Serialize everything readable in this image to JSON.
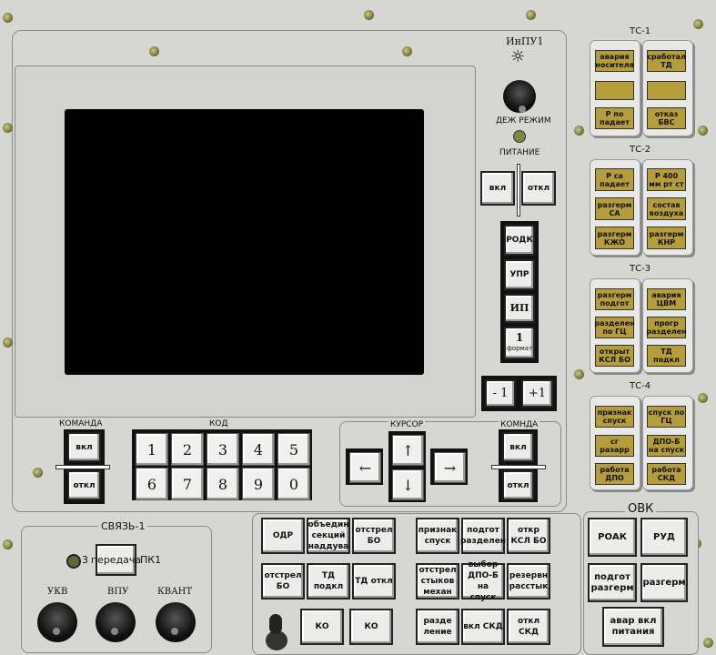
{
  "main": {
    "ikpu_label": "ИнПУ1",
    "dezh_label": "ДЕЖ РЕЖИМ",
    "pitanie_label": "ПИТАНИЕ",
    "pit_on": "вкл",
    "pit_off": "откл",
    "side_buttons": [
      "РОДК",
      "УПР",
      "ИП"
    ],
    "format_num": "1",
    "format_label": "формат",
    "minus": "- 1",
    "plus": "+1",
    "komanda_label": "КОМАНДА",
    "kom_on": "вкл",
    "kom_off": "откл",
    "kod_label": "КОД",
    "keys": [
      "1",
      "2",
      "3",
      "4",
      "5",
      "6",
      "7",
      "8",
      "9",
      "0"
    ],
    "cursor_label": "КУРСОР",
    "komnda_label": "КОМНДА",
    "komnda_on": "вкл",
    "komnda_off": "откл"
  },
  "ts": [
    {
      "title": "ТС-1",
      "cells": [
        "авария носителя",
        "сработал ТД",
        "",
        "",
        "Р по падает",
        "отказ БВС"
      ]
    },
    {
      "title": "ТС-2",
      "cells": [
        "Р са падает",
        "Р 400 мм рт ст",
        "разгерм СА",
        "состав воздуха",
        "разгерм КЖО",
        "разгерм КНР"
      ]
    },
    {
      "title": "ТС-3",
      "cells": [
        "разгерм подгот",
        "авария ЦВМ",
        "разделен по ГЦ",
        "прогр разделен",
        "открыт КСЛ БО",
        "ТД подкл"
      ]
    },
    {
      "title": "ТС-4",
      "cells": [
        "признак спуск",
        "спуск по ГЦ",
        "сг разарр",
        "ДПО-Б на спуск",
        "работа ДПО",
        "работа СКД"
      ]
    }
  ],
  "svyaz": {
    "title": "СВЯЗЬ-1",
    "num": "3",
    "peredacha": "передача",
    "pk1": "ПК1",
    "knobs": [
      "УКВ",
      "ВПУ",
      "КВАНТ"
    ]
  },
  "bottom": {
    "col1": [
      "ОДР",
      "отстрел БО"
    ],
    "col2": [
      "объедин секций наддува",
      "ТД подкл",
      "КО"
    ],
    "col3": [
      "отстрел БО",
      "ТД откл",
      "КО"
    ],
    "col4": [
      "признак спуск",
      "отстрел стыков механ",
      "разде ление"
    ],
    "col5": [
      "подгот разделен",
      "выбор ДПО-Б на спуск",
      "вкл СКД"
    ],
    "col6": [
      "откр КСЛ БО",
      "резервн расстык",
      "откл СКД"
    ],
    "ovk_title": "ОВК",
    "ovk": [
      "РОАК",
      "РУД",
      "подгот разгерм",
      "разгерм",
      "авар вкл питания"
    ]
  },
  "colors": {
    "indicator": "#b59d3c",
    "panel": "#d6d6d2",
    "screen": "#000000"
  }
}
